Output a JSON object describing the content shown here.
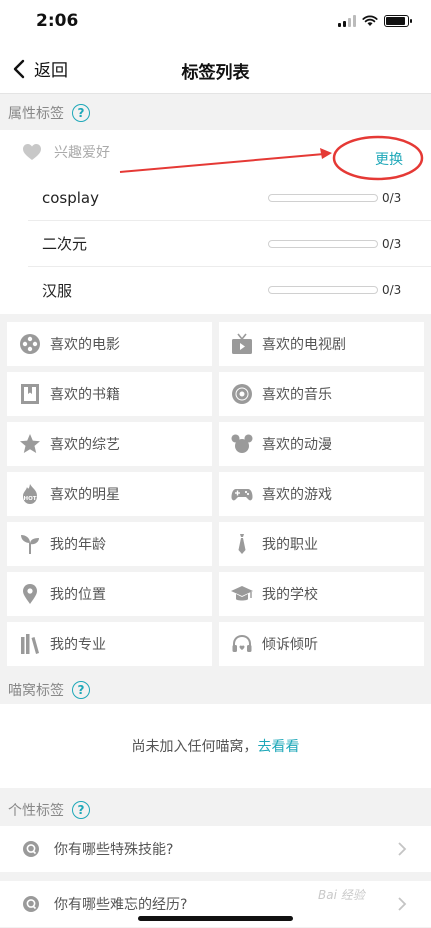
{
  "status_bar": {
    "time": "2:06",
    "battery_level": 0.9,
    "signal_bars_active": 2
  },
  "nav": {
    "back_label": "返回",
    "title": "标签列表"
  },
  "attr_section": {
    "title": "属性标签",
    "help": "?",
    "interest": {
      "label": "兴趣爱好",
      "change_label": "更换",
      "tags": [
        {
          "name": "cosplay",
          "count": "0/3",
          "progress": 0
        },
        {
          "name": "二次元",
          "count": "0/3",
          "progress": 0
        },
        {
          "name": "汉服",
          "count": "0/3",
          "progress": 0
        }
      ]
    },
    "categories": [
      {
        "label": "喜欢的电影",
        "icon": "film-reel-icon"
      },
      {
        "label": "喜欢的电视剧",
        "icon": "tv-icon"
      },
      {
        "label": "喜欢的书籍",
        "icon": "book-icon"
      },
      {
        "label": "喜欢的音乐",
        "icon": "vinyl-icon"
      },
      {
        "label": "喜欢的综艺",
        "icon": "star-icon"
      },
      {
        "label": "喜欢的动漫",
        "icon": "mouse-ears-icon"
      },
      {
        "label": "喜欢的明星",
        "icon": "hot-flame-icon"
      },
      {
        "label": "喜欢的游戏",
        "icon": "gamepad-icon"
      },
      {
        "label": "我的年龄",
        "icon": "sprout-icon"
      },
      {
        "label": "我的职业",
        "icon": "tie-icon"
      },
      {
        "label": "我的位置",
        "icon": "location-pin-icon"
      },
      {
        "label": "我的学校",
        "icon": "graduation-cap-icon"
      },
      {
        "label": "我的专业",
        "icon": "bookshelf-icon"
      },
      {
        "label": "倾诉倾听",
        "icon": "headphones-icon"
      }
    ]
  },
  "nest_section": {
    "title": "喵窝标签",
    "help": "?",
    "empty_text": "尚未加入任何喵窝，",
    "link_text": "去看看"
  },
  "personal_section": {
    "title": "个性标签",
    "help": "?",
    "questions": [
      "你有哪些特殊技能?",
      "你有哪些难忘的经历?"
    ]
  },
  "watermark": "Bai 经验",
  "colors": {
    "accent": "#1fa8b9",
    "annotation": "#e53935",
    "icon_gray": "#9a9a9a"
  }
}
